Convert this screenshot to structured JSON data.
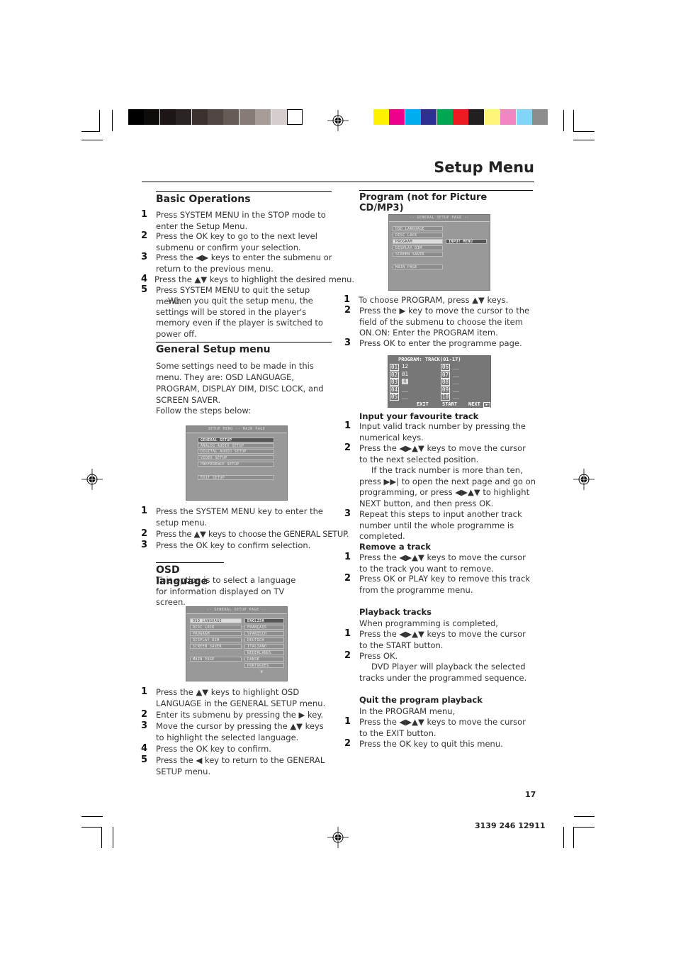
{
  "page": {
    "title": "Setup Menu",
    "page_number": "17",
    "doc_code": "3139 246 12911"
  },
  "print_marks": {
    "grayscale": [
      "#000000",
      "#0e0c0b",
      "#1c1716",
      "#2a2422",
      "#3b312e",
      "#504643",
      "#675b58",
      "#867b77",
      "#a69d99",
      "#d5cecd",
      "#ffffff"
    ],
    "colors": [
      "#fff200",
      "#ec008c",
      "#00aeef",
      "#2e3192",
      "#00a651",
      "#ed1c24",
      "#231f20",
      "#fff57a",
      "#f386c2",
      "#7fd6f7",
      "#8d8d8d"
    ]
  },
  "basic_operations": {
    "heading": "Basic Operations",
    "steps": [
      {
        "n": "1",
        "text": "Press SYSTEM MENU in the STOP mode to enter the Setup Menu."
      },
      {
        "n": "2",
        "text": "Press the OK key to go to the next level submenu or confirm your selection."
      },
      {
        "n": "3",
        "text": "Press the ◀▶ keys to enter the submenu or return to the previous menu."
      },
      {
        "n": "4",
        "text": "Press the ▲▼ keys to highlight the desired menu."
      },
      {
        "n": "5",
        "text": "Press SYSTEM MENU to quit the setup menu."
      }
    ],
    "note": "When you quit the setup menu, the settings will be stored in the player's memory even if the player is switched to power off."
  },
  "general_setup": {
    "heading": "General Setup menu",
    "intro": "Some settings need to be made in this menu. They are: OSD LANGUAGE, PROGRAM, DISPLAY DIM, DISC LOCK, and SCREEN SAVER.",
    "follow": "Follow the steps below:",
    "screen": {
      "header": "SETUP MENU -- MAIN PAGE",
      "items": [
        "GENERAL SETUP",
        "ANALOG AUDIO SETUP",
        "DIGITAL AUDIO SETUP",
        "VIDEO SETUP",
        "PREFERENCE SETUP"
      ],
      "exit": "EXIT SETUP"
    },
    "steps": [
      {
        "n": "1",
        "text": "Press the SYSTEM MENU key to enter the setup menu."
      },
      {
        "n": "2",
        "text": "Press the ▲▼ keys to choose the GENERAL SETUP."
      },
      {
        "n": "3",
        "text": "Press the OK key to confirm selection."
      }
    ]
  },
  "osd_language": {
    "heading": "OSD language",
    "intro": "This option is to select a language for information displayed on TV screen.",
    "screen": {
      "header": "-- GENERAL SETUP PAGE --",
      "items": [
        "OSD LANGUAGE",
        "DISC LOCK",
        "PROGRAM",
        "DISPLAY DIM",
        "SCREEN SAVER"
      ],
      "main_page": "MAIN PAGE",
      "languages": [
        "ENGLISH",
        "FRANÇAIS",
        "SPANISCH",
        "DEUTSCH",
        "ITALIANO",
        "NEDERLANDS",
        "DANSK",
        "PORTUGUES"
      ]
    },
    "steps": [
      {
        "n": "1",
        "text": "Press the ▲▼ keys to highlight OSD LANGUAGE in the GENERAL SETUP menu."
      },
      {
        "n": "2",
        "text": "Enter its submenu by pressing the ▶ key."
      },
      {
        "n": "3",
        "text": "Move the cursor by pressing the ▲▼ keys to highlight the selected language."
      },
      {
        "n": "4",
        "text": "Press the OK key to confirm."
      },
      {
        "n": "5",
        "text": "Press the ◀ key to return to the GENERAL SETUP menu."
      }
    ]
  },
  "program": {
    "heading": "Program (not for Picture CD/MP3)",
    "screen": {
      "header": "-- GENERAL SETUP PAGE --",
      "items": [
        "OSD LANGUAGE",
        "DISC LOCK",
        "PROGRAM",
        "DISPLAY DIM",
        "SCREEN SAVER"
      ],
      "main_page": "MAIN PAGE",
      "submenu": "INPUT MENU"
    },
    "steps": [
      {
        "n": "1",
        "text": "To choose PROGRAM, press ▲▼ keys."
      },
      {
        "n": "2",
        "text": "Press the ▶ key to move the cursor to the field of the submenu to choose the item ON."
      },
      {
        "n": "",
        "text": "ON: Enter the PROGRAM item."
      },
      {
        "n": "3",
        "text": "Press OK to enter the programme page."
      }
    ],
    "program_screen": {
      "title": "PROGRAM: TRACK(01-17)",
      "slots": [
        {
          "slot": "01",
          "value": "12"
        },
        {
          "slot": "02",
          "value": "01"
        },
        {
          "slot": "03",
          "value": "4"
        },
        {
          "slot": "04",
          "value": "__"
        },
        {
          "slot": "05",
          "value": "__"
        },
        {
          "slot": "06",
          "value": "__"
        },
        {
          "slot": "07",
          "value": "__"
        },
        {
          "slot": "08",
          "value": "__"
        },
        {
          "slot": "09",
          "value": "__"
        },
        {
          "slot": "10",
          "value": "__"
        }
      ],
      "buttons": [
        "EXIT",
        "START",
        "NEXT"
      ]
    },
    "input_track": {
      "heading": "Input your favourite track",
      "steps": [
        {
          "n": "1",
          "text": "Input valid track number by pressing the numerical keys."
        },
        {
          "n": "2",
          "text": "Press the ◀▶▲▼ keys to move the cursor to the next selected position."
        }
      ],
      "note": "If the track number is more than ten, press ▶▶| to open the next page and go on programming, or press ◀▶▲▼ to highlight NEXT button, and then press OK.",
      "step3": {
        "n": "3",
        "text": "Repeat this steps to input another track number until the whole programme is completed."
      }
    },
    "remove_track": {
      "heading": "Remove a track",
      "steps": [
        {
          "n": "1",
          "text": "Press the ◀▶▲▼ keys to move the cursor to the track you want to remove."
        },
        {
          "n": "2",
          "text": "Press OK or PLAY key to remove this track from the programme menu."
        }
      ]
    },
    "playback": {
      "heading": "Playback tracks",
      "intro": "When programming is completed,",
      "steps": [
        {
          "n": "1",
          "text": "Press the ◀▶▲▼ keys to move the cursor to the START button."
        },
        {
          "n": "2",
          "text": "Press OK."
        }
      ],
      "note": "DVD Player will playback the selected tracks under the programmed sequence."
    },
    "quit": {
      "heading": "Quit the program playback",
      "intro": "In the PROGRAM menu,",
      "steps": [
        {
          "n": "1",
          "text": "Press the ◀▶▲▼ keys to move the cursor to the EXIT button."
        },
        {
          "n": "2",
          "text": "Press the OK key to quit this menu."
        }
      ]
    }
  }
}
